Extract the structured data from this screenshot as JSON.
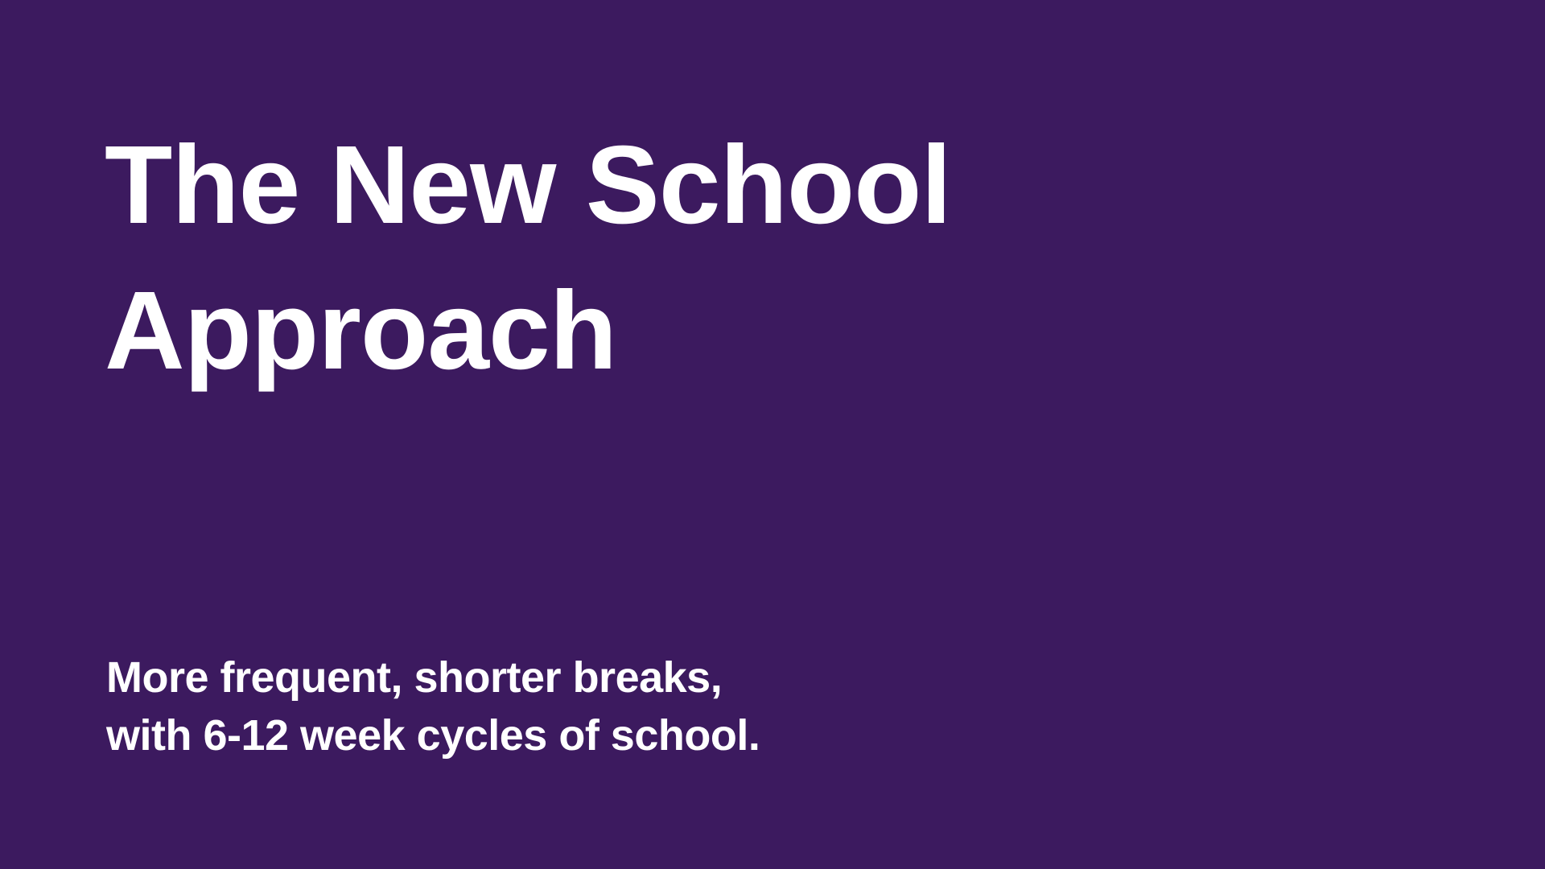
{
  "slide": {
    "background_color": "#3C1A5F",
    "text_color": "#FFFFFF",
    "title_lines": [
      "The New School",
      "Approach"
    ],
    "subtitle_lines": [
      "More frequent, shorter breaks,",
      "with 6-12 week cycles of school."
    ]
  }
}
